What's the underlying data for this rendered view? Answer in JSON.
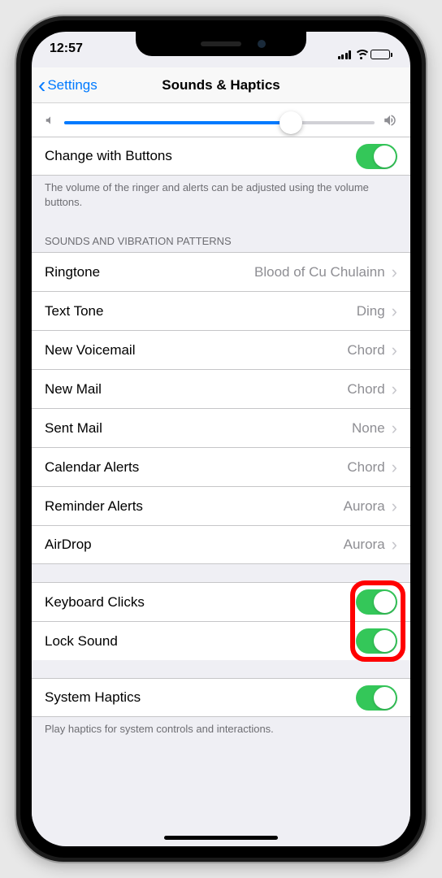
{
  "status": {
    "time": "12:57"
  },
  "nav": {
    "back": "Settings",
    "title": "Sounds & Haptics"
  },
  "volume": {
    "slider_percent": 73
  },
  "changeWithButtons": {
    "label": "Change with Buttons",
    "on": true
  },
  "footer1": "The volume of the ringer and alerts can be adjusted using the volume buttons.",
  "header1": "SOUNDS AND VIBRATION PATTERNS",
  "sounds": [
    {
      "label": "Ringtone",
      "value": "Blood of Cu Chulainn"
    },
    {
      "label": "Text Tone",
      "value": "Ding"
    },
    {
      "label": "New Voicemail",
      "value": "Chord"
    },
    {
      "label": "New Mail",
      "value": "Chord"
    },
    {
      "label": "Sent Mail",
      "value": "None"
    },
    {
      "label": "Calendar Alerts",
      "value": "Chord"
    },
    {
      "label": "Reminder Alerts",
      "value": "Aurora"
    },
    {
      "label": "AirDrop",
      "value": "Aurora"
    }
  ],
  "toggles2": [
    {
      "label": "Keyboard Clicks",
      "on": true
    },
    {
      "label": "Lock Sound",
      "on": true
    }
  ],
  "systemHaptics": {
    "label": "System Haptics",
    "on": true
  },
  "footer2": "Play haptics for system controls and interactions."
}
